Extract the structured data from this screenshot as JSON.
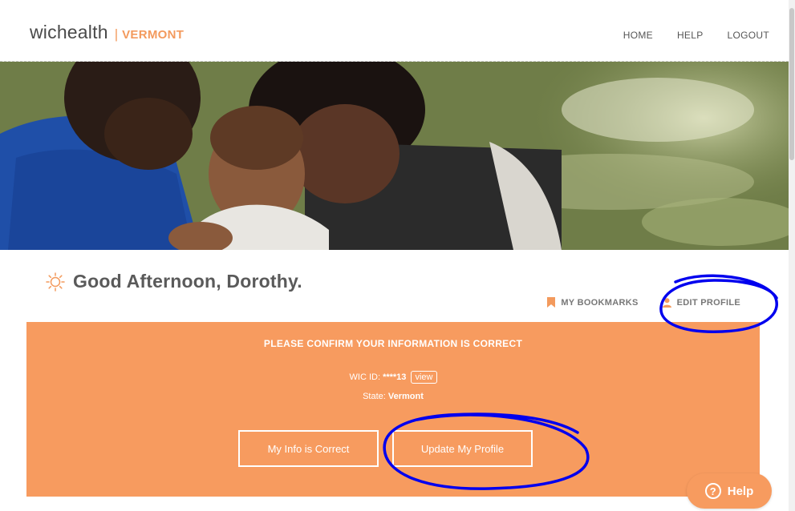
{
  "header": {
    "logo_text": "wichealth",
    "logo_separator": "|",
    "state_label": "VERMONT",
    "nav": [
      {
        "label": "HOME"
      },
      {
        "label": "HELP"
      },
      {
        "label": "LOGOUT"
      }
    ]
  },
  "hero": {
    "icon": "family-photo-hero-image"
  },
  "greeting": {
    "icon": "sun-icon",
    "text": "Good Afternoon, Dorothy."
  },
  "quick_links": {
    "bookmarks": {
      "label": "MY BOOKMARKS",
      "icon": "bookmark-icon"
    },
    "edit_profile": {
      "label": "EDIT PROFILE",
      "icon": "person-icon"
    }
  },
  "confirm_panel": {
    "title": "PLEASE CONFIRM YOUR INFORMATION IS CORRECT",
    "wic_id_label": "WIC ID:",
    "wic_id_value": "****13",
    "view_label": "view",
    "state_label": "State:",
    "state_value": "Vermont",
    "correct_button": "My Info is Correct",
    "update_button": "Update My Profile"
  },
  "help_widget": {
    "label": "Help",
    "icon": "question-icon"
  },
  "colors": {
    "accent": "#f79b5f",
    "annotation": "#0000ee"
  }
}
